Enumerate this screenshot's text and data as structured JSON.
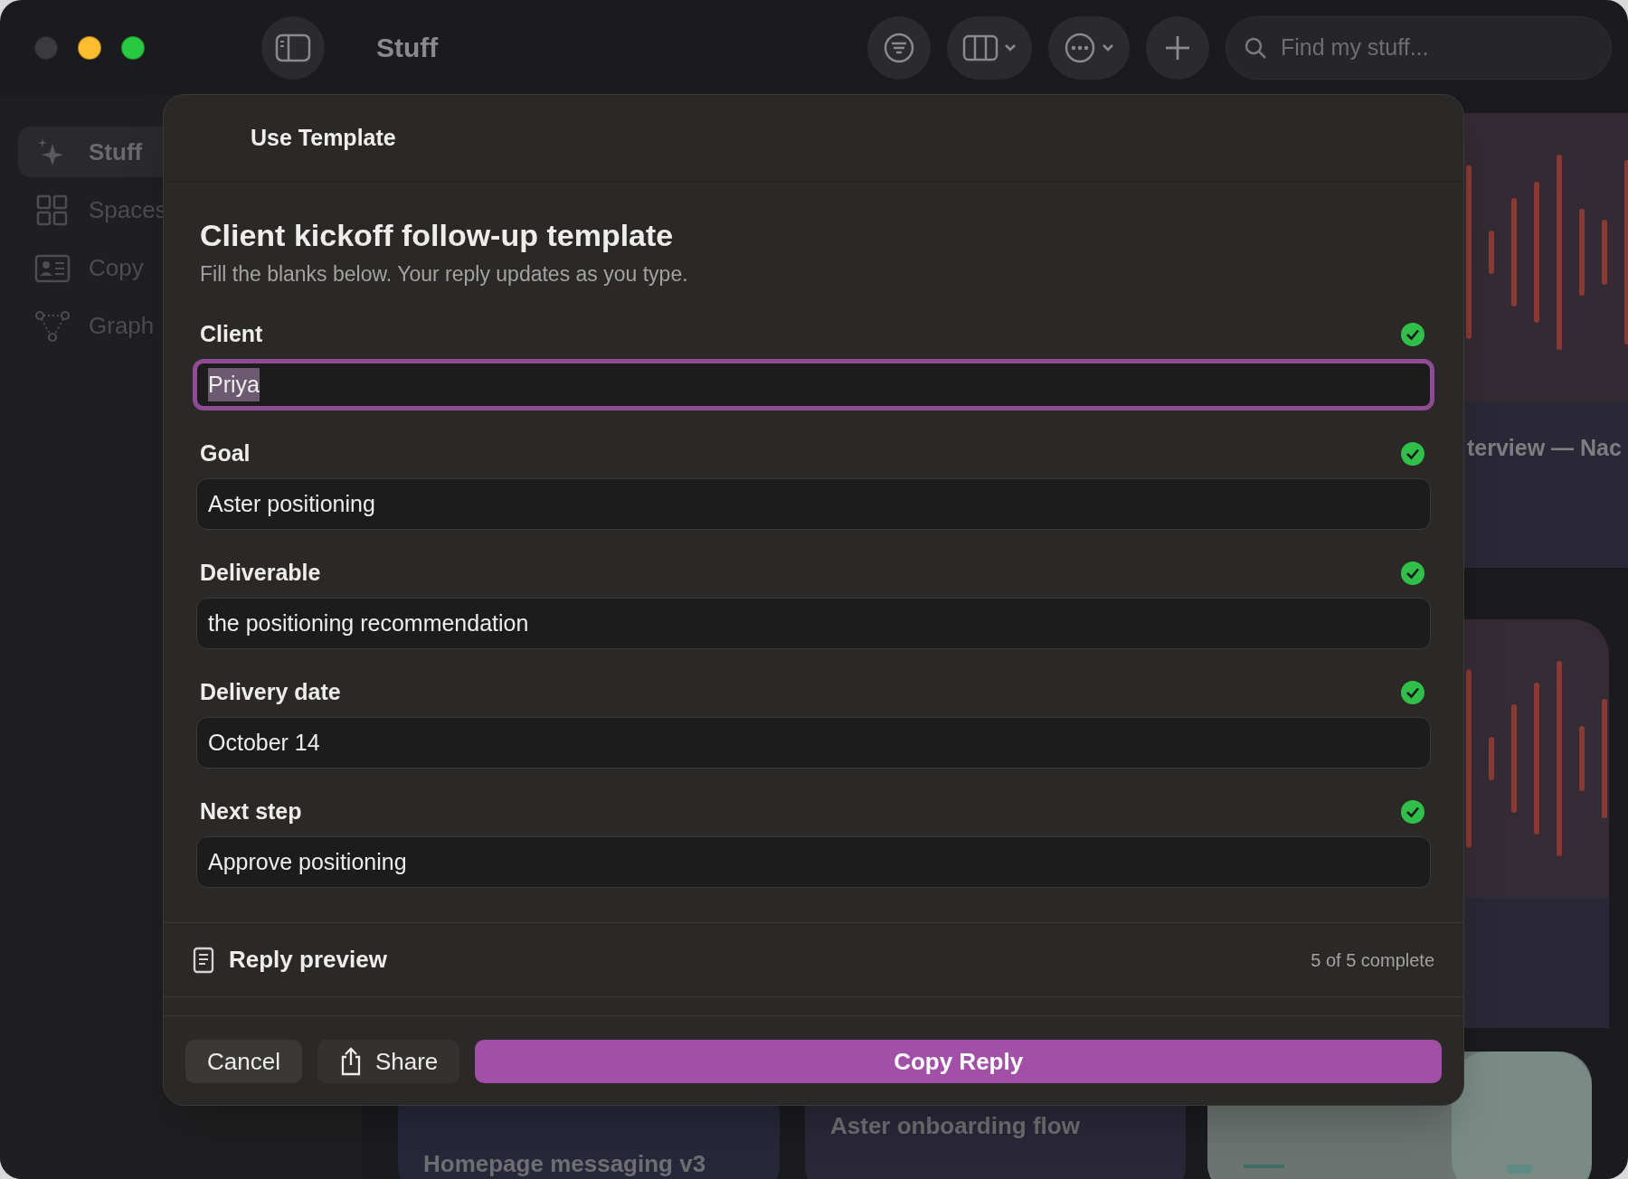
{
  "window": {
    "title": "Stuff"
  },
  "toolbar": {
    "search": {
      "placeholder": "Find my stuff..."
    }
  },
  "sidebar": {
    "items": [
      {
        "label": "Stuff",
        "selected": true
      },
      {
        "label": "Spaces",
        "selected": false
      },
      {
        "label": "Copy",
        "selected": false
      },
      {
        "label": "Graph",
        "selected": false
      }
    ]
  },
  "background_cards": [
    {
      "title": "terview — Nac",
      "kind": "audio"
    },
    {
      "kind": "audio"
    },
    {
      "title": "Homepage messaging v3",
      "kind": "text"
    },
    {
      "title": "Aster onboarding flow",
      "kind": "text"
    },
    {
      "kind": "picture"
    }
  ],
  "dialog": {
    "header": "Use Template",
    "title": "Client kickoff follow-up template",
    "subtitle": "Fill the blanks below. Your reply updates as you type.",
    "fields": [
      {
        "label": "Client",
        "value": "Priya",
        "complete": true,
        "focused": true
      },
      {
        "label": "Goal",
        "value": "Aster positioning",
        "complete": true,
        "focused": false
      },
      {
        "label": "Deliverable",
        "value": "the positioning recommendation",
        "complete": true,
        "focused": false
      },
      {
        "label": "Delivery date",
        "value": "October 14",
        "complete": true,
        "focused": false
      },
      {
        "label": "Next step",
        "value": "Approve positioning",
        "complete": true,
        "focused": false
      }
    ],
    "preview": {
      "label": "Reply preview",
      "status": "5 of 5 complete"
    },
    "buttons": [
      {
        "label": "Cancel",
        "kind": "plain"
      },
      {
        "label": "Share",
        "kind": "share"
      },
      {
        "label": "Copy Reply",
        "kind": "primary"
      }
    ]
  }
}
